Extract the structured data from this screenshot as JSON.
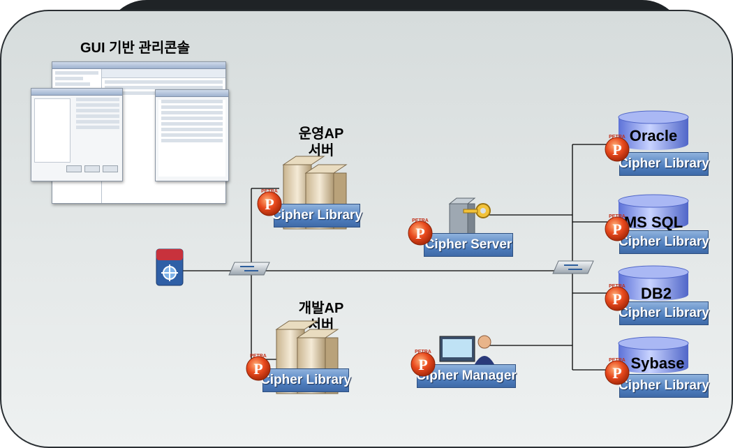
{
  "title": "GUI 기반 관리콘솔",
  "servers": {
    "prod": {
      "line1": "운영AP",
      "line2": "서버",
      "library": "Cipher Library"
    },
    "dev": {
      "line1": "개발AP",
      "line2": "서버",
      "library": "Cipher Library"
    }
  },
  "cipher_server": {
    "label": "Cipher Server"
  },
  "cipher_manager": {
    "label": "Cipher Manager"
  },
  "databases": [
    {
      "name": "Oracle",
      "library": "Cipher Library"
    },
    {
      "name": "MS SQL",
      "library": "Cipher Library"
    },
    {
      "name": "DB2",
      "library": "Cipher Library"
    },
    {
      "name": "Sybase",
      "library": "Cipher Library"
    }
  ],
  "petra_badge": "PETRA",
  "petra_letter": "P",
  "colors": {
    "library_box": "#4f7fbf",
    "panel": "#e4e8e8",
    "badge": "#e8491d",
    "db": "#8fa4f0"
  }
}
